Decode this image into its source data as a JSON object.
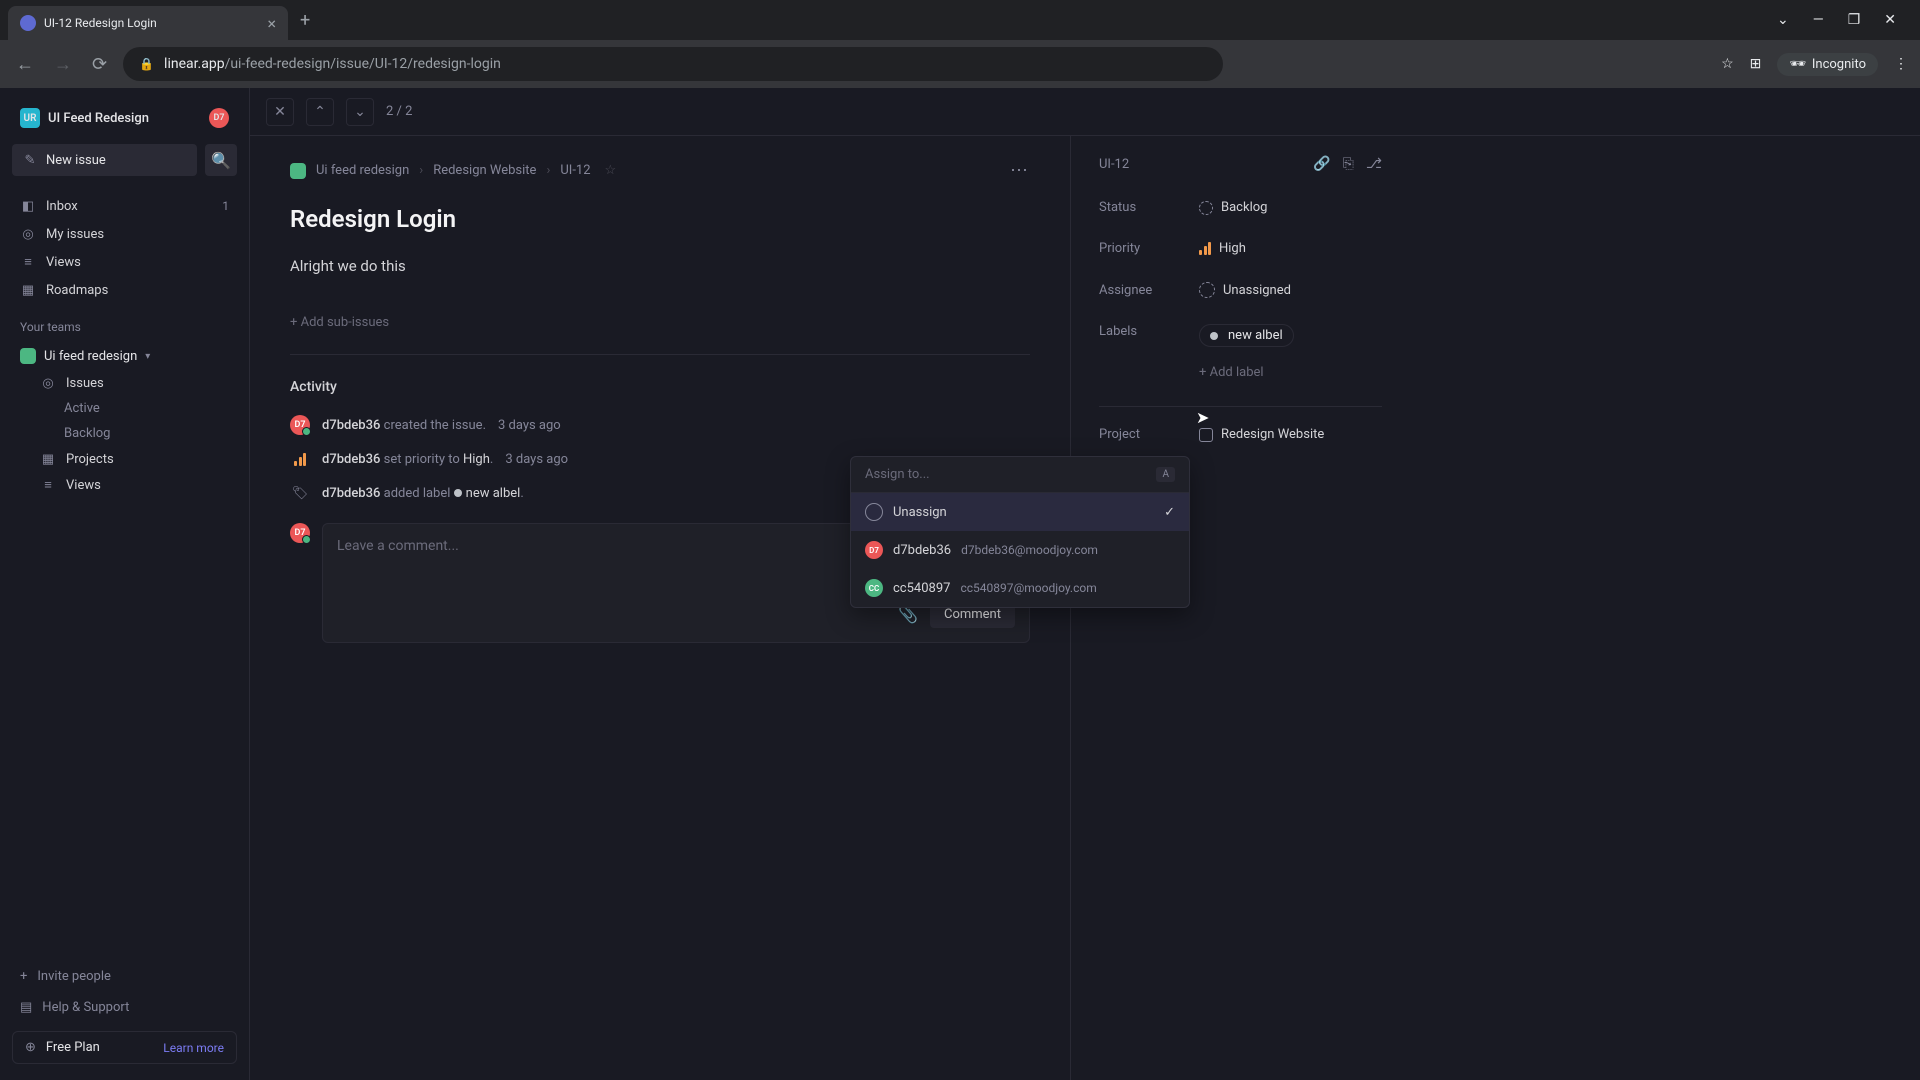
{
  "browser": {
    "tab_title": "UI-12 Redesign Login",
    "url_host": "linear.app",
    "url_path": "/ui-feed-redesign/issue/UI-12/redesign-login",
    "incognito": "Incognito"
  },
  "sidebar": {
    "workspace_icon": "UR",
    "workspace_name": "UI Feed Redesign",
    "user_badge": "D7",
    "new_issue": "New issue",
    "inbox": "Inbox",
    "inbox_count": "1",
    "my_issues": "My issues",
    "views": "Views",
    "roadmaps": "Roadmaps",
    "your_teams": "Your teams",
    "team_name": "Ui feed redesign",
    "issues": "Issues",
    "active": "Active",
    "backlog": "Backlog",
    "projects": "Projects",
    "team_views": "Views",
    "invite": "Invite people",
    "help": "Help & Support",
    "free_plan": "Free Plan",
    "learn_more": "Learn more"
  },
  "header": {
    "counter": "2 / 2"
  },
  "breadcrumbs": {
    "team": "Ui feed redesign",
    "project": "Redesign Website",
    "issue_id": "UI-12"
  },
  "issue": {
    "title": "Redesign Login",
    "description": "Alright we do this",
    "add_subissues": "+ Add sub-issues"
  },
  "activity": {
    "title": "Activity",
    "items": [
      {
        "user": "d7bdeb36",
        "action": "created the issue.",
        "time": "3 days ago"
      },
      {
        "user": "d7bdeb36",
        "action": "set priority to",
        "value": "High",
        "time": "3 days ago"
      },
      {
        "user": "d7bdeb36",
        "action": "added label",
        "label": "new albel"
      }
    ],
    "comment_placeholder": "Leave a comment...",
    "comment_btn": "Comment"
  },
  "panel": {
    "issue_id": "UI-12",
    "status_label": "Status",
    "status_value": "Backlog",
    "priority_label": "Priority",
    "priority_value": "High",
    "assignee_label": "Assignee",
    "assignee_value": "Unassigned",
    "labels_label": "Labels",
    "label_value": "new albel",
    "add_label": "+ Add label",
    "project_label": "Project",
    "project_value": "Redesign Website"
  },
  "assign_dropdown": {
    "placeholder": "Assign to...",
    "kbd": "A",
    "options": [
      {
        "name": "Unassign",
        "selected": true
      },
      {
        "name": "d7bdeb36",
        "email": "d7bdeb36@moodjoy.com",
        "badge": "D7"
      },
      {
        "name": "cc540897",
        "email": "cc540897@moodjoy.com",
        "badge": "CC"
      }
    ]
  }
}
